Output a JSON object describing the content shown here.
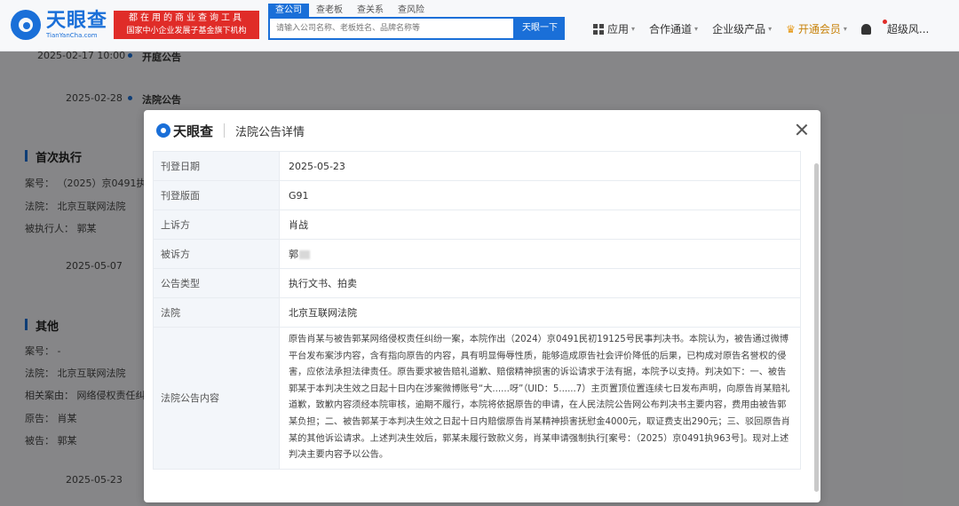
{
  "header": {
    "logo_cn": "天眼查",
    "logo_en": "TianYanCha.com",
    "slogan_line1": "都在用的商业查询工具",
    "slogan_line2": "国家中小企业发展子基金旗下机构",
    "search_tabs": [
      "查公司",
      "查老板",
      "查关系",
      "查风险"
    ],
    "search_placeholder": "请输入公司名称、老板姓名、品牌名称等",
    "search_button": "天眼一下",
    "nav": {
      "apps": "应用",
      "partner": "合作通道",
      "enterprise": "企业级产品",
      "vip": "开通会员",
      "user": "超级风..."
    }
  },
  "background": {
    "timeline": [
      {
        "date": "2025-02-17 10:00",
        "event": "开庭公告"
      },
      {
        "date": "2025-02-28",
        "event": "法院公告"
      }
    ],
    "section1": {
      "title": "首次执行",
      "case_no": "案号： （2025）京0491执",
      "court": "法院： 北京互联网法院",
      "executed": "被执行人： 郭某",
      "date": "2025-05-07"
    },
    "section2": {
      "title": "其他",
      "case_no": "案号： -",
      "court": "法院： 北京互联网法院",
      "cause": "相关案由： 网络侵权责任纠",
      "plaintiff": "原告： 肖某",
      "defendant": "被告： 郭某",
      "date": "2025-05-23"
    }
  },
  "modal": {
    "logo": "天眼查",
    "title": "法院公告详情",
    "rows": [
      {
        "key": "刊登日期",
        "value": "2025-05-23"
      },
      {
        "key": "刊登版面",
        "value": "G91"
      },
      {
        "key": "上诉方",
        "value": "肖战"
      },
      {
        "key": "被诉方",
        "value": "郭"
      },
      {
        "key": "公告类型",
        "value": "执行文书、拍卖"
      },
      {
        "key": "法院",
        "value": "北京互联网法院"
      }
    ],
    "content_key": "法院公告内容",
    "content": "原告肖某与被告郭某网络侵权责任纠纷一案，本院作出（2024）京0491民初19125号民事判决书。本院认为，被告通过微博平台发布案涉内容，含有指向原告的内容，具有明显侮辱性质，能够造成原告社会评价降低的后果，已构成对原告名誉权的侵害，应依法承担法律责任。原告要求被告赔礼道歉、赔偿精神损害的诉讼请求于法有据，本院予以支持。判决如下：一、被告郭某于本判决生效之日起十日内在涉案微博账号“大......呀”（UID：5......7）主页置顶位置连续七日发布声明，向原告肖某赔礼道歉，致歉内容须经本院审核，逾期不履行，本院将依据原告的申请，在人民法院公告网公布判决书主要内容，费用由被告郭某负担；二、被告郭某于本判决生效之日起十日内赔偿原告肖某精神损害抚慰金4000元，取证费支出290元；三、驳回原告肖某的其他诉讼请求。上述判决生效后，郭某未履行致款义务，肖某申请强制执行[案号：（2025）京0491执963号]。现对上述判决主要内容予以公告。"
  }
}
